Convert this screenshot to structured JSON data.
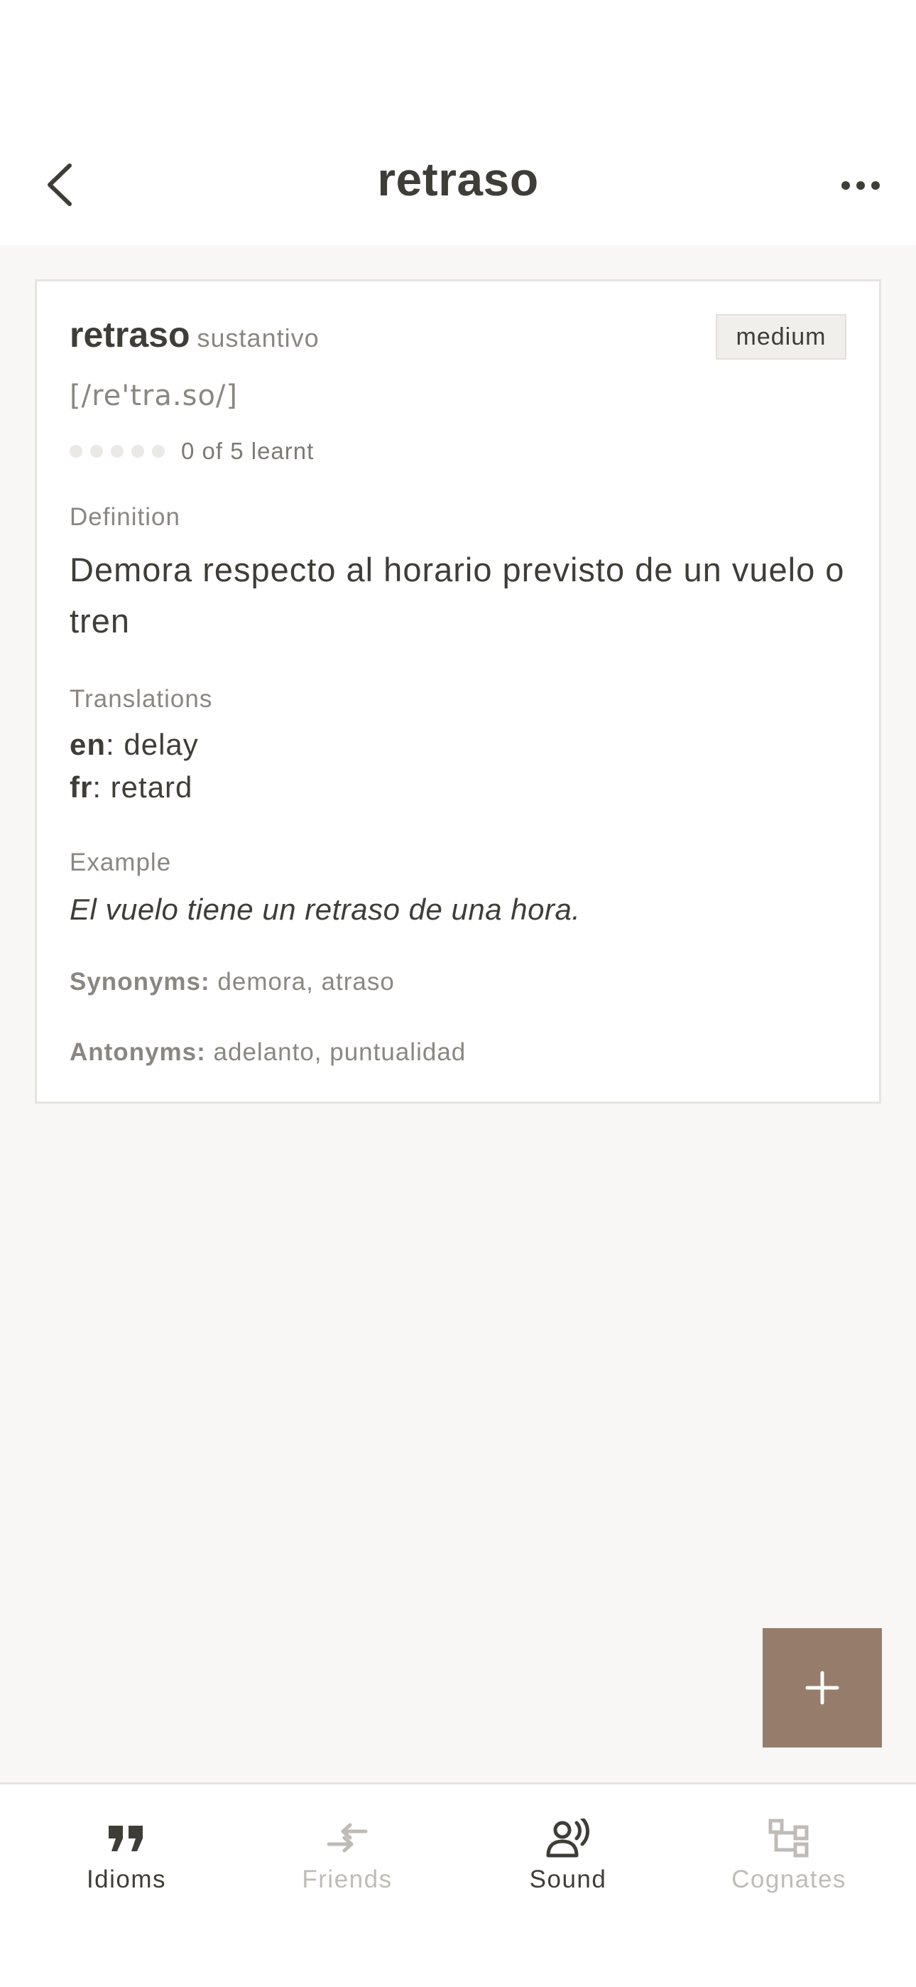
{
  "header": {
    "title": "retraso",
    "back_icon": "chevron-left-icon",
    "more_icon": "ellipsis-icon"
  },
  "entry": {
    "word": "retraso",
    "part_of_speech": "sustantivo",
    "difficulty": "medium",
    "ipa": "[/re'tra.so/]",
    "progress": {
      "learnt": 0,
      "total": 5,
      "text": "0 of 5 learnt"
    },
    "definition_label": "Definition",
    "definition": "Demora respecto al horario previsto de un vuelo o tren",
    "translations_label": "Translations",
    "translations": [
      {
        "lang": "en",
        "text": ": delay"
      },
      {
        "lang": "fr",
        "text": ": retard"
      }
    ],
    "example_label": "Example",
    "example": "El vuelo tiene un retraso de una hora.",
    "synonyms_label": "Synonyms:",
    "synonyms": "demora, atraso",
    "antonyms_label": "Antonyms:",
    "antonyms": "adelanto, puntualidad"
  },
  "fab": {
    "icon": "plus-icon"
  },
  "tabs": [
    {
      "label": "Idioms",
      "icon": "quote-icon",
      "active": true
    },
    {
      "label": "Friends",
      "icon": "arrows-icon",
      "active": false
    },
    {
      "label": "Sound",
      "icon": "speaking-person-icon",
      "active": true
    },
    {
      "label": "Cognates",
      "icon": "tree-diagram-icon",
      "active": false
    }
  ],
  "colors": {
    "text": "#3f3d38",
    "muted": "#8a8782",
    "accent": "#967d6b",
    "background": "#f8f7f5",
    "inactive_tab": "#bfbcb8"
  }
}
